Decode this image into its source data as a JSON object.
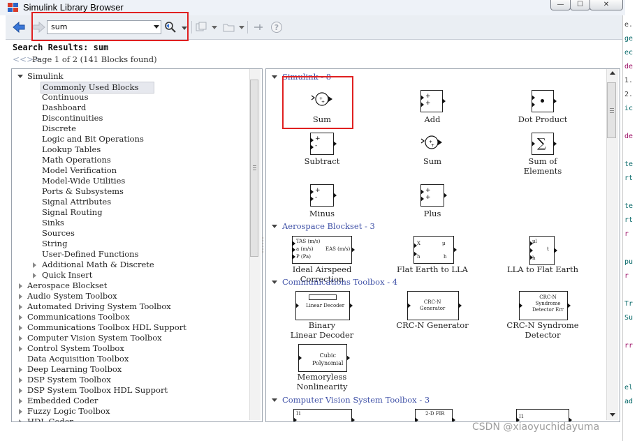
{
  "window": {
    "title": "Simulink Library Browser",
    "minimize_glyph": "—",
    "maximize_glyph": "☐",
    "close_glyph": "✕"
  },
  "toolbar": {
    "search_value": "sum",
    "icons": [
      "back-arrow-icon",
      "forward-arrow-icon",
      "search-icon",
      "new-model-icon",
      "open-folder-icon",
      "pin-icon",
      "help-icon"
    ]
  },
  "results": {
    "title": "Search Results: sum",
    "pager_arrows": "<<>>",
    "pager_text": "Page 1 of 2 (141 Blocks found)"
  },
  "tree": {
    "root": "Simulink",
    "simulink_children": [
      "Commonly Used Blocks",
      "Continuous",
      "Dashboard",
      "Discontinuities",
      "Discrete",
      "Logic and Bit Operations",
      "Lookup Tables",
      "Math Operations",
      "Model Verification",
      "Model-Wide Utilities",
      "Ports & Subsystems",
      "Signal Attributes",
      "Signal Routing",
      "Sinks",
      "Sources",
      "String",
      "User-Defined Functions"
    ],
    "simulink_expandable": [
      "Additional Math & Discrete",
      "Quick Insert"
    ],
    "toolboxes": [
      "Aerospace Blockset",
      "Audio System Toolbox",
      "Automated Driving System Toolbox",
      "Communications Toolbox",
      "Communications Toolbox HDL Support",
      "Computer Vision System Toolbox",
      "Control System Toolbox",
      "Data Acquisition Toolbox",
      "Deep Learning Toolbox",
      "DSP System Toolbox",
      "DSP System Toolbox HDL Support",
      "Embedded Coder",
      "Fuzzy Logic Toolbox",
      "HDL Coder"
    ],
    "no_expander": [
      "Data Acquisition Toolbox"
    ]
  },
  "groups": [
    {
      "label": "Simulink - 8"
    },
    {
      "label": "Aerospace Blockset - 3"
    },
    {
      "label": "Communications Toolbox - 4"
    },
    {
      "label": "Computer Vision System Toolbox - 3"
    }
  ],
  "blocks": {
    "simulink": [
      {
        "label": "Sum"
      },
      {
        "label": "Add"
      },
      {
        "label": "Dot Product"
      },
      {
        "label": "Subtract"
      },
      {
        "label": "Sum"
      },
      {
        "label": "Sum of\nElements"
      },
      {
        "label": "Minus"
      },
      {
        "label": "Plus"
      }
    ],
    "aerospace": [
      {
        "label": "Ideal Airspeed Correction",
        "ports": [
          "TAS (m/s)",
          "a  (m/s)",
          "P  (Pa)",
          "EAS (m/s)"
        ]
      },
      {
        "label": "Flat Earth to LLA",
        "ports": [
          "X",
          "h",
          "μ",
          "h"
        ]
      },
      {
        "label": "LLA to Flat Earth",
        "ports": [
          "μl",
          "h",
          "t"
        ]
      }
    ],
    "communications": [
      {
        "label": "Binary\nLinear Decoder",
        "inner": "Linear Decoder"
      },
      {
        "label": "CRC-N Generator",
        "inner": "CRC-N\nGenerator"
      },
      {
        "label": "CRC-N Syndrome\nDetector",
        "inner": "CRC-N\nSyndrome\nDetector  Err"
      },
      {
        "label": "Memoryless\nNonlinearity",
        "inner": "Cubic\nPolynomial"
      }
    ],
    "vision": [
      {
        "inner": "I1"
      },
      {
        "inner": "2-D FIR"
      },
      {
        "inner": "I1"
      }
    ]
  },
  "background_code": [
    "e.",
    "ge",
    "ec",
    "de",
    "1.",
    "2.",
    "ic",
    "",
    "de",
    "",
    "te",
    "rt",
    "",
    "te",
    "rt",
    "r",
    "",
    "pu",
    "r",
    "",
    "Tr",
    "Su",
    "",
    "rr",
    "",
    "",
    "el",
    "ad"
  ],
  "watermark": "CSDN @xiaoyuchidayuma"
}
